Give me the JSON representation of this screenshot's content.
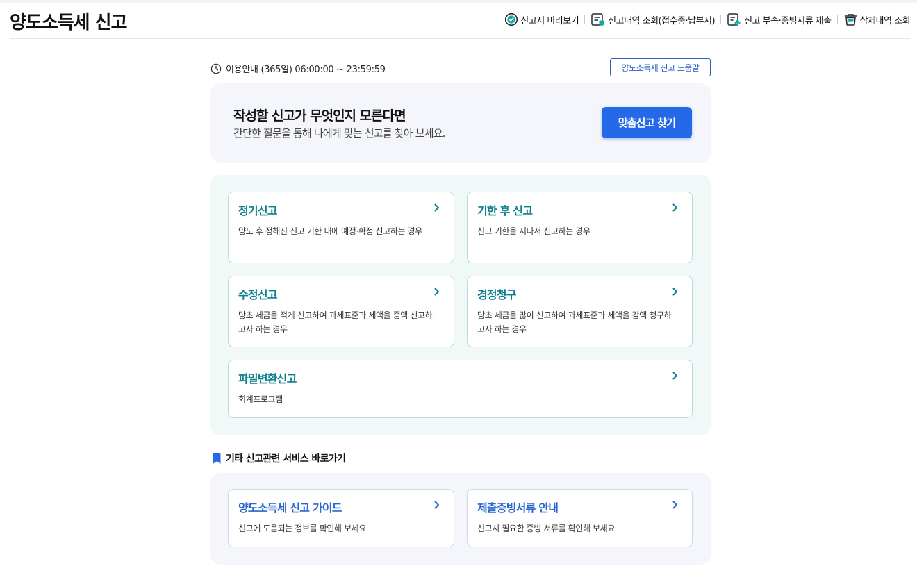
{
  "header": {
    "title": "양도소득세 신고",
    "nav": [
      {
        "label": "신고서 미리보기",
        "icon": "preview-check-icon"
      },
      {
        "label": "신고내역 조회(접수증·납부서)",
        "icon": "document-list-icon"
      },
      {
        "label": "신고 부속·증빙서류 제출",
        "icon": "document-upload-icon"
      },
      {
        "label": "삭제내역 조회",
        "icon": "trash-icon"
      }
    ]
  },
  "info": {
    "hours": "이용안내 (365일) 06:00:00 ~ 23:59:59",
    "help_button": "양도소득세 신고 도움말"
  },
  "banner": {
    "title": "작성할 신고가 무엇인지 모른다면",
    "subtitle": "간단한 질문을 통해 나에게 맞는 신고를 찾아 보세요.",
    "button": "맞춤신고 찾기"
  },
  "report_types": [
    {
      "title": "정기신고",
      "desc": "양도 후 정해진 신고 기한 내에 예정·확정 신고하는 경우"
    },
    {
      "title": "기한 후 신고",
      "desc": "신고 기한을 지나서 신고하는 경우"
    },
    {
      "title": "수정신고",
      "desc": "당초 세금을 적게 신고하여 과세표준과 세액을 증액 신고하고자 하는 경우"
    },
    {
      "title": "경정청구",
      "desc": "당초 세금을 많이 신고하여 과세표준과 세액을 감액 청구하고자 하는 경우"
    },
    {
      "title": "파일변환신고",
      "desc": "회계프로그램"
    }
  ],
  "other_services": {
    "title": "기타 신고관련 서비스 바로가기",
    "items": [
      {
        "title": "양도소득세 신고 가이드",
        "desc": "신고에 도움되는 정보를 확인해 보세요"
      },
      {
        "title": "제출증빙서류 안내",
        "desc": "신고시 필요한 증빙 서류를 확인해 보세요"
      }
    ]
  },
  "colors": {
    "primary_blue": "#2569e8",
    "teal_title": "#0c7f8c",
    "blue_title": "#2a66cf",
    "panel_green": "#f1f9f8",
    "panel_blue": "#f4f6fb"
  }
}
